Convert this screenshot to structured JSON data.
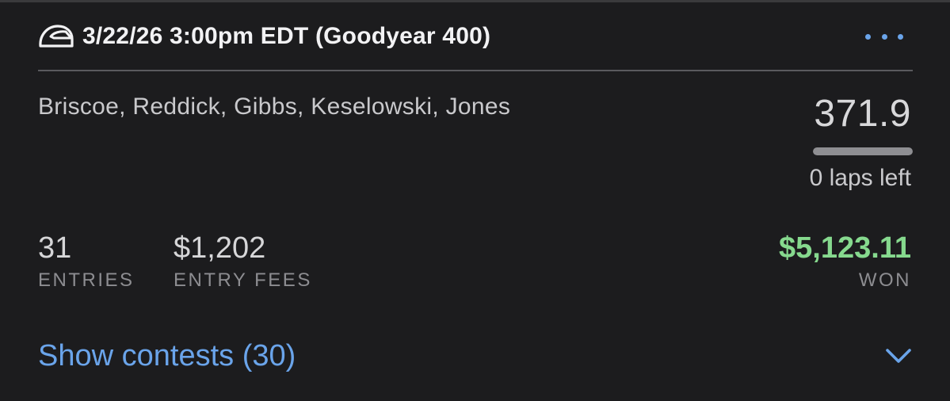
{
  "header": {
    "title": "3/22/26 3:00pm EDT (Goodyear 400)",
    "icon": "helmet-icon",
    "more_icon": "more-horizontal-icon"
  },
  "lineup": {
    "drivers": "Briscoe, Reddick, Gibbs, Keselowski, Jones",
    "score": "371.9",
    "progress": 1.0,
    "laps_left": "0 laps left"
  },
  "stats": {
    "entries": {
      "value": "31",
      "label": "ENTRIES"
    },
    "entry_fees": {
      "value": "$1,202",
      "label": "ENTRY FEES"
    },
    "won": {
      "value": "$5,123.11",
      "label": "WON"
    }
  },
  "footer": {
    "show_contests": "Show contests (30)",
    "chevron_icon": "chevron-down-icon"
  },
  "colors": {
    "background": "#1c1c1e",
    "accent_blue": "#6aa4ea",
    "won_green": "#86d98e"
  }
}
